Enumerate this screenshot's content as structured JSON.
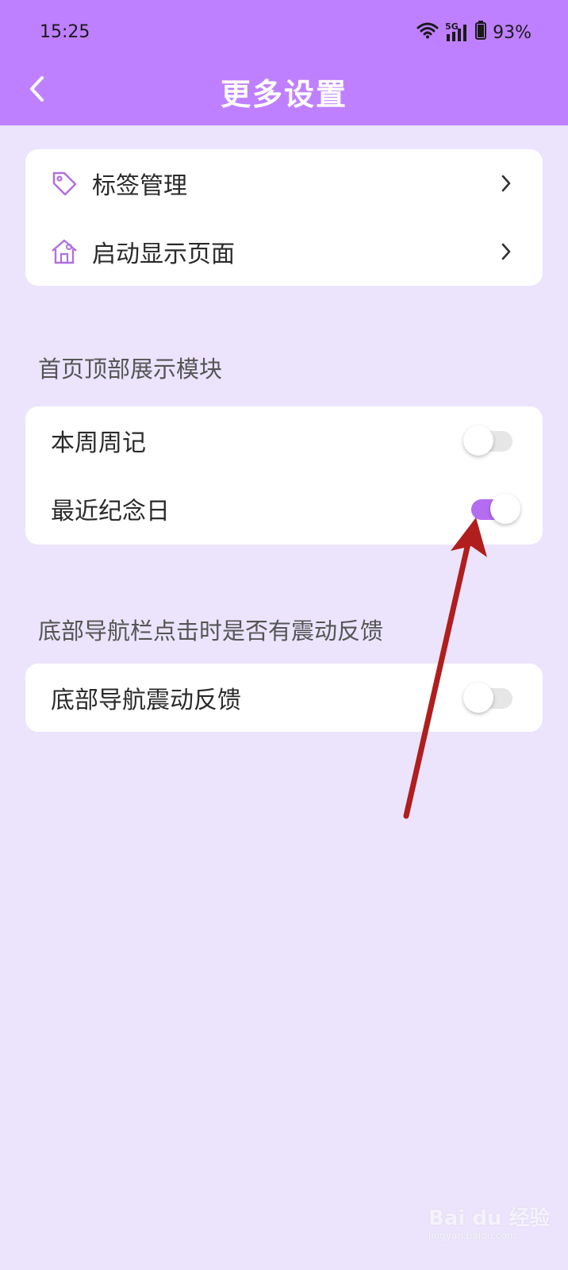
{
  "status_bar": {
    "time": "15:25",
    "network": "5G",
    "battery": "93%"
  },
  "header": {
    "title": "更多设置",
    "back_icon": "chevron-left-icon"
  },
  "card1": {
    "items": [
      {
        "label": "标签管理",
        "icon": "tag-icon"
      },
      {
        "label": "启动显示页面",
        "icon": "house-icon"
      }
    ]
  },
  "section_top": {
    "title": "首页顶部展示模块",
    "items": [
      {
        "label": "本周周记",
        "enabled": false
      },
      {
        "label": "最近纪念日",
        "enabled": true
      }
    ]
  },
  "section_bottom": {
    "title": "底部导航栏点击时是否有震动反馈",
    "items": [
      {
        "label": "底部导航震动反馈",
        "enabled": false
      }
    ]
  },
  "colors": {
    "header_bg": "#bf80ff",
    "page_bg": "#ebe4fc",
    "switch_on": "#b46cf0",
    "annotation_arrow": "#b01e1e"
  },
  "watermark": {
    "logo": "Bai du 经验",
    "sub": "jingyan.baidu.com"
  }
}
